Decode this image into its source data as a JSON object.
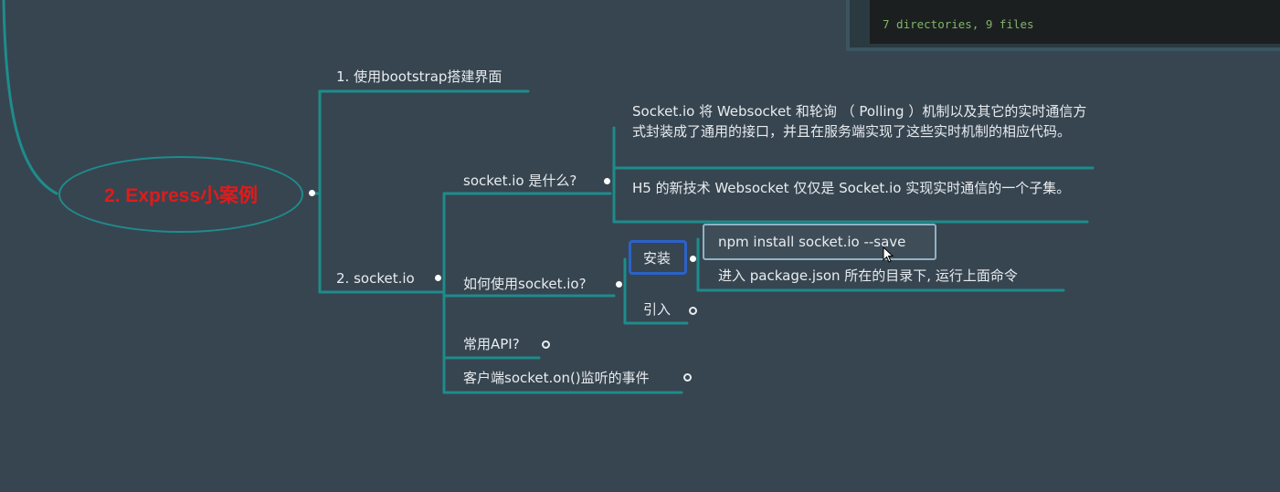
{
  "terminal": {
    "text": "7 directories, 9 files"
  },
  "mindmap": {
    "root": "2. Express小案例",
    "branch1": "1. 使用bootstrap搭建界面",
    "branch2": "2. socket.io",
    "what": "socket.io 是什么?",
    "what_desc1": "Socket.io 将 Websocket 和轮询 （ Polling ）机制以及其它的实时通信方式封装成了通用的接口，并且在服务端实现了这些实时机制的相应代码。",
    "what_desc2": "H5 的新技术 Websocket 仅仅是 Socket.io 实现实时通信的一个子集。",
    "how": "如何使用socket.io?",
    "install": "安装",
    "npm_cmd": "npm install socket.io --save",
    "npm_note": "进入 package.json  所在的目录下, 运行上面命令",
    "import": "引入",
    "api": "常用API?",
    "client_events": "客户端socket.on()监听的事件"
  },
  "colors": {
    "background": "#374550",
    "branch_line": "#1e8c8c",
    "root_text": "#e01b1b",
    "selected_border": "#2b62c9"
  }
}
